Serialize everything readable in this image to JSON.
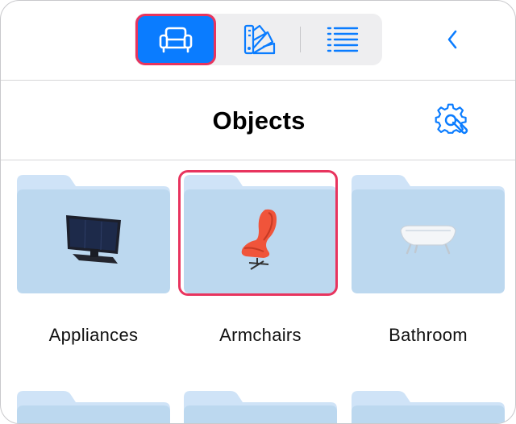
{
  "toolbar": {
    "segments": [
      {
        "name": "objects",
        "icon": "armchair-icon",
        "selected": true
      },
      {
        "name": "materials",
        "icon": "color-swatch-icon",
        "selected": false
      },
      {
        "name": "list",
        "icon": "list-icon",
        "selected": false
      }
    ],
    "back_icon": "chevron-left-icon"
  },
  "header": {
    "title": "Objects",
    "settings_icon": "gear-wrench-icon"
  },
  "categories": [
    {
      "label": "Appliances",
      "thumbnail": "television-icon",
      "selected": false
    },
    {
      "label": "Armchairs",
      "thumbnail": "egg-chair-icon",
      "selected": true
    },
    {
      "label": "Bathroom",
      "thumbnail": "bathtub-icon",
      "selected": false
    }
  ],
  "colors": {
    "accent": "#0a7cff",
    "highlight": "#e8345e",
    "folder_back": "#cfe3f7",
    "folder_front": "#bcd8ef"
  }
}
